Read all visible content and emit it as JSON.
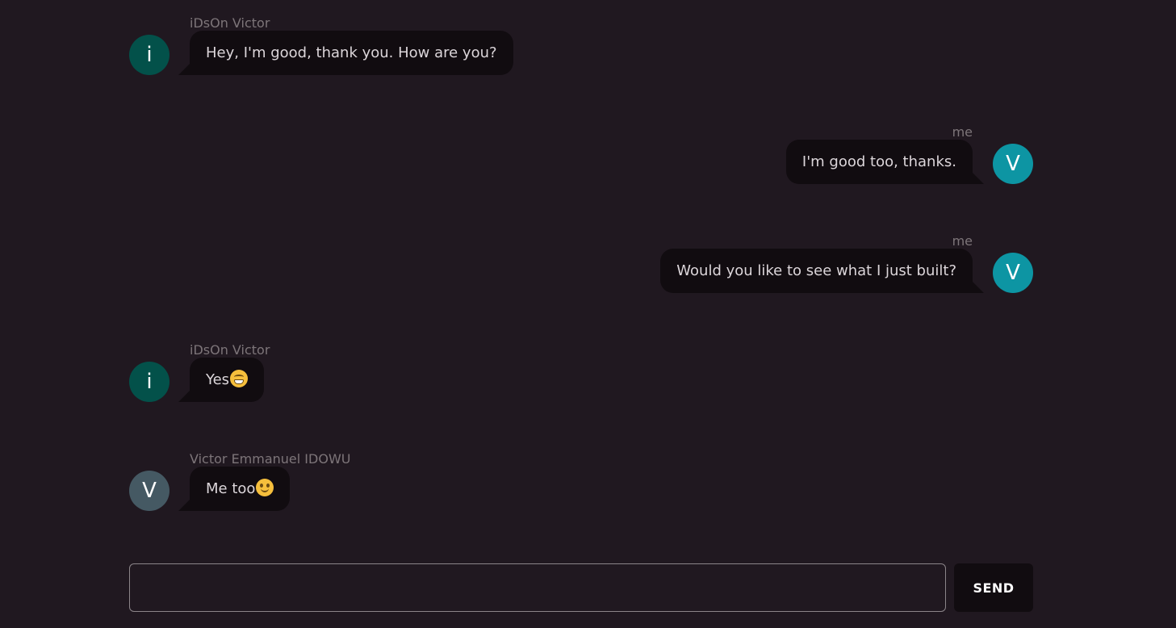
{
  "colors": {
    "background": "#201820",
    "bubble": "#110c10",
    "avatar_incoming": "#03514a",
    "avatar_outgoing": "#0d95a3",
    "avatar_other": "#455963"
  },
  "messages": [
    {
      "direction": "in",
      "sender": "iDsOn Victor",
      "avatar_letter": "i",
      "text": "Hey, I'm good, thank you. How are you?"
    },
    {
      "direction": "out",
      "sender": "me",
      "avatar_letter": "V",
      "text": "I'm good too, thanks."
    },
    {
      "direction": "out",
      "sender": "me",
      "avatar_letter": "V",
      "text": "Would you like to see what I just built?"
    },
    {
      "direction": "in",
      "sender": "iDsOn Victor",
      "avatar_letter": "i",
      "text": "Yes",
      "emoji": "grinning-face-icon"
    },
    {
      "direction": "in",
      "sender": "Victor Emmanuel IDOWU",
      "avatar_letter": "V",
      "text": "Me too",
      "emoji": "slightly-smiling-face-icon"
    }
  ],
  "composer": {
    "input_value": "",
    "input_placeholder": "",
    "send_label": "SEND"
  }
}
